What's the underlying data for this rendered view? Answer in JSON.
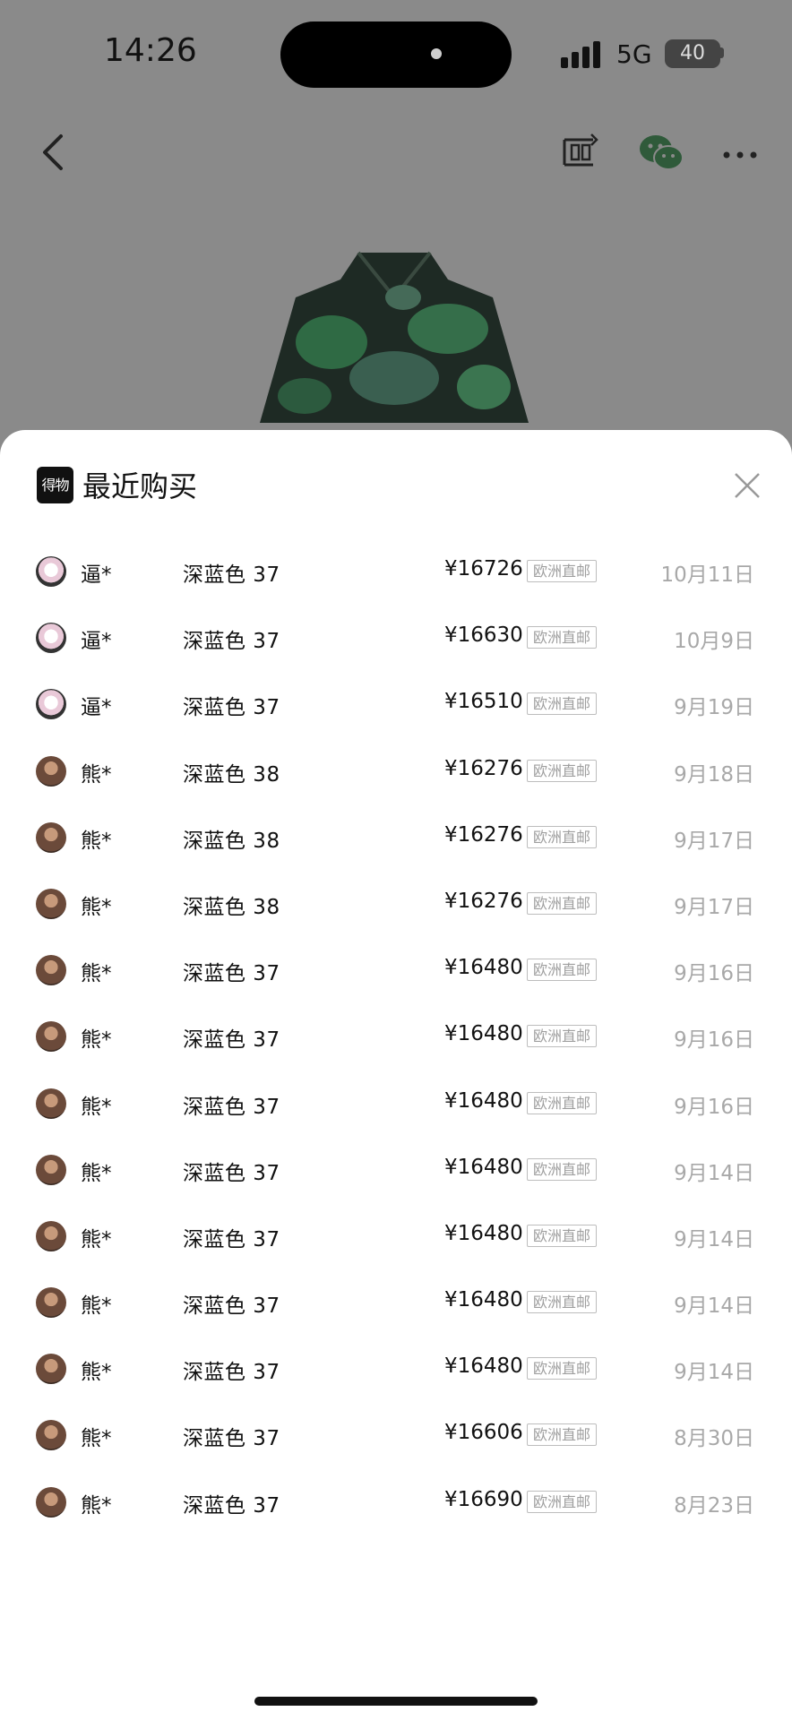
{
  "status": {
    "time": "14:26",
    "network": "5G",
    "battery": "40"
  },
  "sheet": {
    "logo": "得物",
    "title": "最近购买"
  },
  "purchases": [
    {
      "user": "逼*",
      "variant": "深蓝色 37",
      "price": "¥16726",
      "badge": "欧洲直邮",
      "date": "10月11日",
      "avatar": "a"
    },
    {
      "user": "逼*",
      "variant": "深蓝色 37",
      "price": "¥16630",
      "badge": "欧洲直邮",
      "date": "10月9日",
      "avatar": "a"
    },
    {
      "user": "逼*",
      "variant": "深蓝色 37",
      "price": "¥16510",
      "badge": "欧洲直邮",
      "date": "9月19日",
      "avatar": "a"
    },
    {
      "user": "熊*",
      "variant": "深蓝色 38",
      "price": "¥16276",
      "badge": "欧洲直邮",
      "date": "9月18日",
      "avatar": "b"
    },
    {
      "user": "熊*",
      "variant": "深蓝色 38",
      "price": "¥16276",
      "badge": "欧洲直邮",
      "date": "9月17日",
      "avatar": "b"
    },
    {
      "user": "熊*",
      "variant": "深蓝色 38",
      "price": "¥16276",
      "badge": "欧洲直邮",
      "date": "9月17日",
      "avatar": "b"
    },
    {
      "user": "熊*",
      "variant": "深蓝色 37",
      "price": "¥16480",
      "badge": "欧洲直邮",
      "date": "9月16日",
      "avatar": "b"
    },
    {
      "user": "熊*",
      "variant": "深蓝色 37",
      "price": "¥16480",
      "badge": "欧洲直邮",
      "date": "9月16日",
      "avatar": "b"
    },
    {
      "user": "熊*",
      "variant": "深蓝色 37",
      "price": "¥16480",
      "badge": "欧洲直邮",
      "date": "9月16日",
      "avatar": "b"
    },
    {
      "user": "熊*",
      "variant": "深蓝色 37",
      "price": "¥16480",
      "badge": "欧洲直邮",
      "date": "9月14日",
      "avatar": "b"
    },
    {
      "user": "熊*",
      "variant": "深蓝色 37",
      "price": "¥16480",
      "badge": "欧洲直邮",
      "date": "9月14日",
      "avatar": "b"
    },
    {
      "user": "熊*",
      "variant": "深蓝色 37",
      "price": "¥16480",
      "badge": "欧洲直邮",
      "date": "9月14日",
      "avatar": "b"
    },
    {
      "user": "熊*",
      "variant": "深蓝色 37",
      "price": "¥16480",
      "badge": "欧洲直邮",
      "date": "9月14日",
      "avatar": "b"
    },
    {
      "user": "熊*",
      "variant": "深蓝色 37",
      "price": "¥16606",
      "badge": "欧洲直邮",
      "date": "8月30日",
      "avatar": "b"
    },
    {
      "user": "熊*",
      "variant": "深蓝色 37",
      "price": "¥16690",
      "badge": "欧洲直邮",
      "date": "8月23日",
      "avatar": "b"
    }
  ]
}
